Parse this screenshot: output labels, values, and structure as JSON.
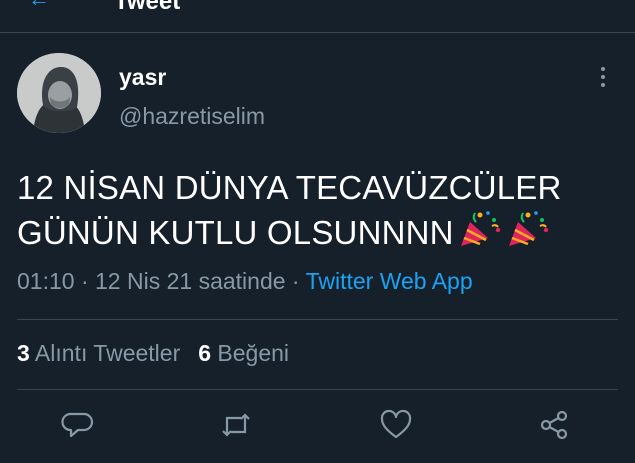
{
  "header": {
    "title": "Tweet",
    "back_icon": "back-arrow-icon"
  },
  "tweet": {
    "name": "yasr",
    "handle": "@hazretiselim",
    "text_line1": "12 NİSAN DÜNYA TECAVÜZCÜLER",
    "text_line2": "GÜNÜN KUTLU OLSUNNNN",
    "emoji": "party-popper-icon",
    "time": "01:10",
    "date": "12 Nis 21 saatinde",
    "separator": "·",
    "source": "Twitter Web App"
  },
  "stats": {
    "quote_count": "3",
    "quote_label": "Alıntı Tweetler",
    "like_count": "6",
    "like_label": "Beğeni"
  },
  "actions": [
    "reply-icon",
    "retweet-icon",
    "like-icon",
    "share-icon"
  ],
  "colors": {
    "background": "#15202b",
    "accent": "#1da1f2",
    "secondary_text": "#8899a6",
    "divider": "#38444d"
  }
}
